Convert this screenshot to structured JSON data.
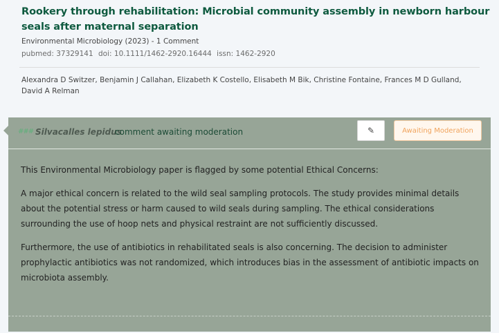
{
  "article": {
    "title": "Rookery through rehabilitation: Microbial community assembly in newborn harbour seals after maternal separation",
    "journal_line": "Environmental Microbiology (2023) - 1 Comment",
    "pubmed": "pubmed: 37329141",
    "doi": "doi: 10.1111/1462-2920.16444",
    "issn": "issn: 1462-2920",
    "authors": "Alexandra D Switzer, Benjamin J Callahan, Elizabeth K Costello, Elisabeth M Bik, Christine Fontaine, Frances M D Gulland, David A Relman"
  },
  "comment": {
    "user_icon": "hash-icon",
    "username": "Silvacalles lepidus",
    "status_text": "comment awaiting moderation",
    "edit_icon": "pencil-icon",
    "badge_label": "Awaiting Moderation",
    "paragraphs": [
      "This Environmental Microbiology paper is flagged by some potential Ethical Concerns:",
      "A major ethical concern is related to the wild seal sampling protocols. The study provides minimal details about the potential stress or harm caused to wild seals during sampling. The ethical considerations surrounding the use of hoop nets and physical restraint are not sufficiently discussed.",
      "Furthermore, the use of antibiotics in rehabilitated seals is also concerning. The decision to administer prophylactic antibiotics was not randomized, which introduces bias in the assessment of antibiotic impacts on microbiota assembly."
    ]
  },
  "colors": {
    "title": "#0e5a3f",
    "panel": "#97a597",
    "badge_text": "#f0a35c",
    "user_icon": "#5fb07a"
  }
}
